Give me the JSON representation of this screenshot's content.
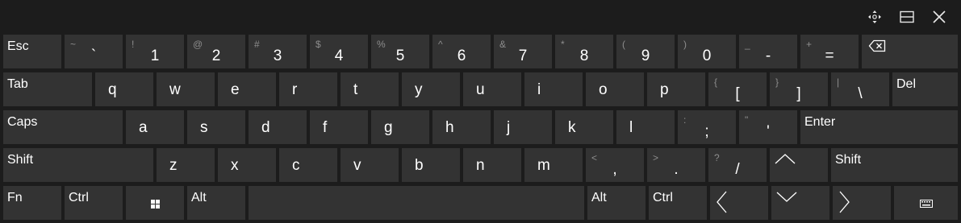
{
  "titlebar": {
    "move_icon": "four-way-arrows",
    "dock_icon": "dock-rectangle",
    "close_icon": "close-x"
  },
  "rows": {
    "numbers": [
      {
        "label": "Esc"
      },
      {
        "top": "~",
        "main": "`"
      },
      {
        "top": "!",
        "main": "1"
      },
      {
        "top": "@",
        "main": "2"
      },
      {
        "top": "#",
        "main": "3"
      },
      {
        "top": "$",
        "main": "4"
      },
      {
        "top": "%",
        "main": "5"
      },
      {
        "top": "^",
        "main": "6"
      },
      {
        "top": "&",
        "main": "7"
      },
      {
        "top": "*",
        "main": "8"
      },
      {
        "top": "(",
        "main": "9"
      },
      {
        "top": ")",
        "main": "0"
      },
      {
        "top": "_",
        "main": "-"
      },
      {
        "top": "+",
        "main": "="
      },
      {
        "icon": "backspace-icon"
      }
    ],
    "qwerty": [
      {
        "label": "Tab"
      },
      {
        "main": "q"
      },
      {
        "main": "w"
      },
      {
        "main": "e"
      },
      {
        "main": "r"
      },
      {
        "main": "t"
      },
      {
        "main": "y"
      },
      {
        "main": "u"
      },
      {
        "main": "i"
      },
      {
        "main": "o"
      },
      {
        "main": "p"
      },
      {
        "top": "{",
        "main": "["
      },
      {
        "top": "}",
        "main": "]"
      },
      {
        "top": "|",
        "main": "\\"
      },
      {
        "label": "Del"
      }
    ],
    "home": [
      {
        "label": "Caps"
      },
      {
        "main": "a"
      },
      {
        "main": "s"
      },
      {
        "main": "d"
      },
      {
        "main": "f"
      },
      {
        "main": "g"
      },
      {
        "main": "h"
      },
      {
        "main": "j"
      },
      {
        "main": "k"
      },
      {
        "main": "l"
      },
      {
        "top": ":",
        "main": ";"
      },
      {
        "top": "\"",
        "main": "'"
      },
      {
        "label": "Enter"
      }
    ],
    "shift": [
      {
        "label": "Shift"
      },
      {
        "main": "z"
      },
      {
        "main": "x"
      },
      {
        "main": "c"
      },
      {
        "main": "v"
      },
      {
        "main": "b"
      },
      {
        "main": "n"
      },
      {
        "main": "m"
      },
      {
        "top": "<",
        "main": ","
      },
      {
        "top": ">",
        "main": "."
      },
      {
        "top": "?",
        "main": "/"
      },
      {
        "icon": "arrow-up-icon"
      },
      {
        "label": "Shift"
      }
    ],
    "bottom": [
      {
        "label": "Fn"
      },
      {
        "label": "Ctrl"
      },
      {
        "icon": "windows-logo-icon"
      },
      {
        "label": "Alt"
      },
      {
        "label": ""
      },
      {
        "label": "Alt"
      },
      {
        "label": "Ctrl"
      },
      {
        "icon": "arrow-left-icon"
      },
      {
        "icon": "arrow-down-icon"
      },
      {
        "icon": "arrow-right-icon"
      },
      {
        "icon": "keyboard-icon"
      }
    ]
  }
}
